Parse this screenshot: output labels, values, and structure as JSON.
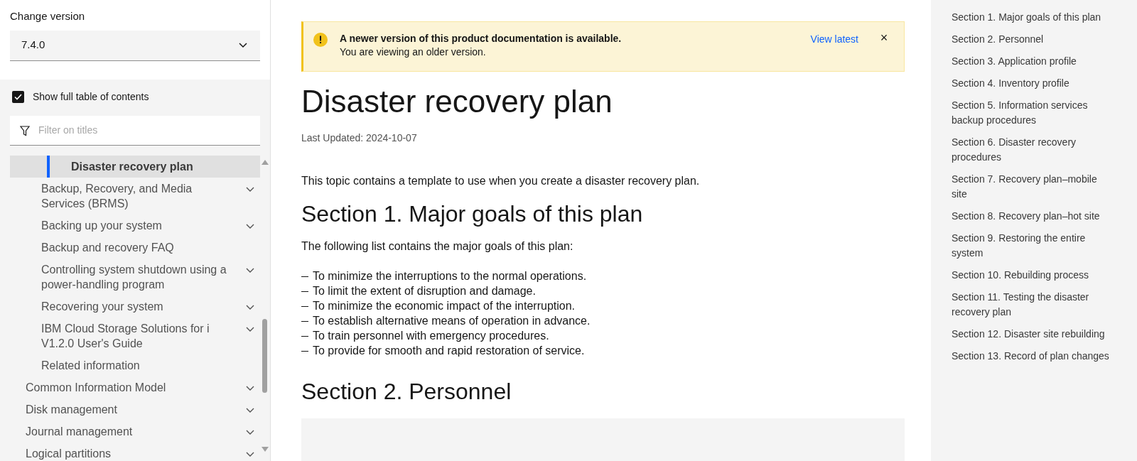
{
  "sidebar": {
    "version_label": "Change version",
    "version_select": {
      "value": "7.4.0"
    },
    "show_full_toc": {
      "label": "Show full table of contents",
      "checked": true
    },
    "filter": {
      "placeholder": "Filter on titles"
    },
    "toc": [
      {
        "children": [
          {
            "children": [
              {
                "label": "Disaster recovery plan",
                "selected": true,
                "expandable": false
              }
            ]
          },
          {
            "label": "Backup, Recovery, and Media Services (BRMS)",
            "selected": false,
            "expandable": true
          },
          {
            "label": "Backing up your system",
            "selected": false,
            "expandable": true
          },
          {
            "label": "Backup and recovery FAQ",
            "selected": false,
            "expandable": false
          },
          {
            "label": "Controlling system shutdown using a power-handling program",
            "selected": false,
            "expandable": true
          },
          {
            "label": "Recovering your system",
            "selected": false,
            "expandable": true
          },
          {
            "label": "IBM Cloud Storage Solutions for i V1.2.0 User's Guide",
            "selected": false,
            "expandable": true
          },
          {
            "label": "Related information",
            "selected": false,
            "expandable": false
          }
        ]
      },
      {
        "label": "Common Information Model",
        "selected": false,
        "expandable": true
      },
      {
        "label": "Disk management",
        "selected": false,
        "expandable": true
      },
      {
        "label": "Journal management",
        "selected": false,
        "expandable": true
      },
      {
        "label": "Logical partitions",
        "selected": false,
        "expandable": true
      }
    ]
  },
  "banner": {
    "title": "A newer version of this product documentation is available.",
    "message": "You are viewing an older version.",
    "link": "View latest",
    "close": "×"
  },
  "article": {
    "title": "Disaster recovery plan",
    "updated": "Last Updated: 2024-10-07",
    "intro": "This topic contains a template to use when you create a disaster recovery plan.",
    "sections": [
      {
        "heading": "Section 1. Major goals of this plan",
        "lead": "The following list contains the major goals of this plan:",
        "bullets": [
          "To minimize the interruptions to the normal operations.",
          "To limit the extent of disruption and damage.",
          "To minimize the economic impact of the interruption.",
          "To establish alternative means of operation in advance.",
          "To train personnel with emergency procedures.",
          "To provide for smooth and rapid restoration of service."
        ]
      },
      {
        "heading": "Section 2. Personnel"
      }
    ]
  },
  "on_this_page": [
    "Section 1. Major goals of this plan",
    "Section 2. Personnel",
    "Section 3. Application profile",
    "Section 4. Inventory profile",
    "Section 5. Information services backup procedures",
    "Section 6. Disaster recovery procedures",
    "Section 7. Recovery plan–mobile site",
    "Section 8. Recovery plan–hot site",
    "Section 9. Restoring the entire system",
    "Section 10. Rebuilding process",
    "Section 11. Testing the disaster recovery plan",
    "Section 12. Disaster site rebuilding",
    "Section 13. Record of plan changes"
  ]
}
